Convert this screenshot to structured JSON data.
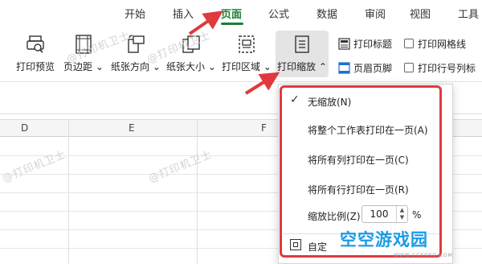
{
  "menu": {
    "tabs": [
      "开始",
      "插入",
      "页面",
      "公式",
      "数据",
      "审阅",
      "视图",
      "工具"
    ],
    "active": "页面"
  },
  "ribbon": {
    "print_preview": "打印预览",
    "margins": "页边距",
    "orientation": "纸张方向",
    "paper_size": "纸张大小",
    "print_area": "打印区域",
    "print_scale": "打印缩放",
    "print_titles": "打印标题",
    "header_footer": "页眉页脚",
    "print_gridlines": "打印网格线",
    "print_row_col_headings": "打印行号列标"
  },
  "sheet": {
    "columns": [
      "D",
      "E",
      "F"
    ]
  },
  "watermark": "@打印机卫士",
  "dropdown": {
    "items": [
      "无缩放(N)",
      "将整个工作表打印在一页(A)",
      "将所有列打印在一页(C)",
      "将所有行打印在一页(R)"
    ],
    "scale_label": "缩放比例(Z)",
    "scale_value": "100",
    "scale_unit": "%",
    "custom_label": "自定"
  },
  "logo": {
    "text": "空空游戏园",
    "sub": "WWW.CCKOKO.COM"
  },
  "colors": {
    "accent_green": "#1a7f37",
    "highlight_red": "#e0393e",
    "logo_blue": "#1a9be8"
  }
}
